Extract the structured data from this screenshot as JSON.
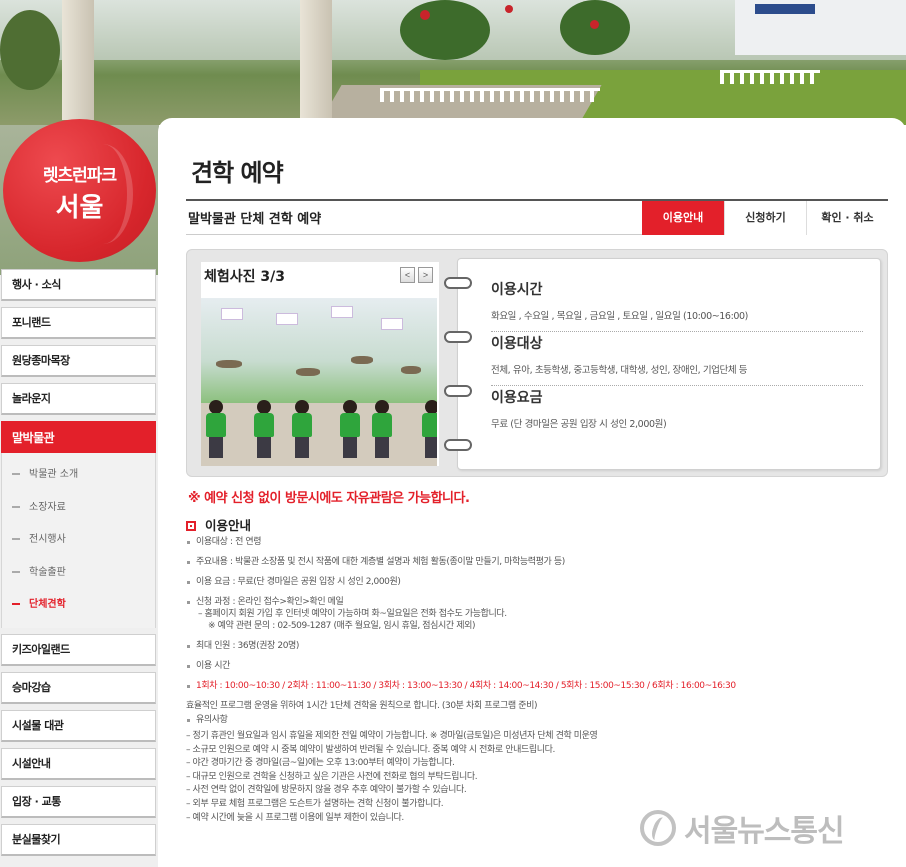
{
  "logo": {
    "line1": "렛츠런파크",
    "line2": "서울"
  },
  "nav": {
    "items_top": [
      "행사 · 소식",
      "포니랜드",
      "원당종마목장",
      "놀라운지"
    ],
    "active": "말박물관",
    "sub": [
      "박물관 소개",
      "소장자료",
      "전시행사",
      "학술출판",
      "단체견학"
    ],
    "items_bottom": [
      "키즈아일랜드",
      "승마강습",
      "시설물 대관",
      "시설안내",
      "입장 · 교통",
      "분실물찾기"
    ]
  },
  "page": {
    "title": "견학 예약",
    "subtitle": "말박물관 단체 견학 예약",
    "tabs": [
      "이용안내",
      "신청하기",
      "확인 · 취소"
    ]
  },
  "photo": {
    "title": "체험사진 3/3",
    "prev": "<",
    "next": ">"
  },
  "info": [
    {
      "heading": "이용시간",
      "text": "화요일 , 수요일 , 목요일 , 금요일 , 토요일 , 일요일 (10:00~16:00)"
    },
    {
      "heading": "이용대상",
      "text": "전체, 유아, 초등학생, 중고등학생, 대학생, 성인, 장애인, 기업단체 등"
    },
    {
      "heading": "이용요금",
      "text": "무료 (단 경마일은 공원 입장 시 성인 2,000원)"
    }
  ],
  "notice": "※ 예약 신청 없이 방문시에도 자유관람은 가능합니다.",
  "guide": {
    "title": "이용안내",
    "items": [
      "이용대상 : 전 연령",
      "주요내용 : 박물관 소장품 및 전시 작품에 대한 계층별 설명과 체험 활동(종이말 만들기, 마학능력평가 등)",
      "이용 요금 : 무료(단 경마일은 공원 입장 시 성인 2,000원)"
    ],
    "process": "신청 과정 : 온라인 접수>확인>확인 메일",
    "process_sub1": "– 홈페이지 회원 가입 후 인터넷 예약이 가능하며 화~일요일은 전화 접수도 가능합니다.",
    "process_sub2": "※ 예약 관련 문의 : 02-509-1287 (매주 월요일, 임시 휴일, 점심시간 제외)",
    "max": "최대 인원 : 36명(권장 20명)",
    "time_label": "이용 시간",
    "sessions": "1회차 : 10:00~10:30 / 2회차 : 11:00~11:30 / 3회차 : 13:00~13:30 / 4회차 : 14:00~14:30 / 5회차 : 15:00~15:30 / 6회차 : 16:00~16:30",
    "efficiency": "효율적인 프로그램 운영을 위하여 1시간 1단체 견학을 원칙으로 합니다. (30분 차회 프로그램 준비)",
    "caution_label": "유의사항",
    "cautions": [
      "– 정기 휴관인 월요일과 임시 휴일을 제외한 전일 예약이 가능합니다. ※ 경마일(금토일)은 미성년자 단체 견학 미운영",
      "– 소규모 인원으로 예약 시 중복 예약이 발생하여 반려될 수 있습니다. 중복 예약 시 전화로 안내드립니다.",
      "– 야간 경마기간 중 경마일(금~일)에는 오후 13:00부터 예약이 가능합니다.",
      "– 대규모 인원으로 견학을 신청하고 싶은 기관은 사전에 전화로 협의 부탁드립니다.",
      "– 사전 연락 없이 견학일에 방문하지 않을 경우 추후 예약이 불가할 수 있습니다.",
      "– 외부 무료 체험 프로그램은 도슨트가 설명하는 견학 신청이 불가합니다.",
      "– 예약 시간에 늦을 시 프로그램 이용에 일부 제한이 있습니다."
    ]
  },
  "watermark": "서울뉴스통신",
  "colors": {
    "accent": "#e3202a",
    "nav_bg": "#efefef"
  }
}
